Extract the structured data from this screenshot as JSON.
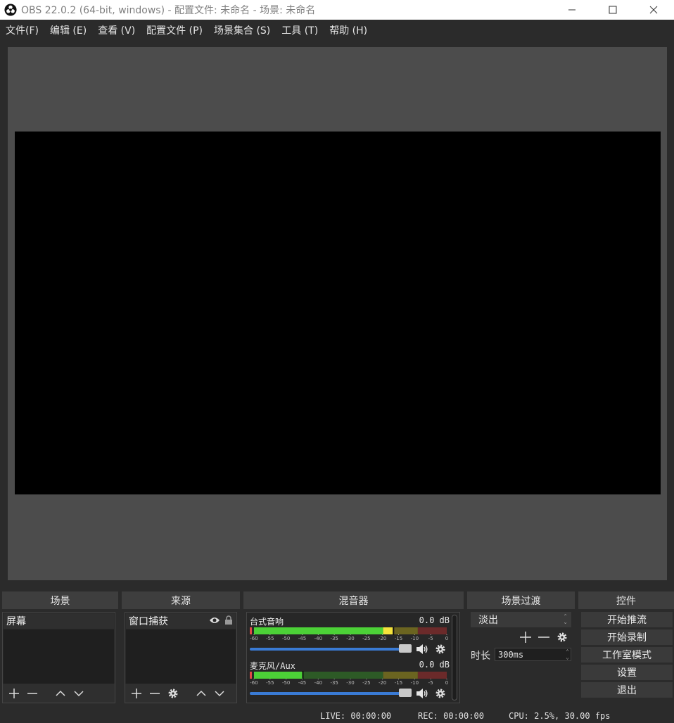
{
  "window": {
    "title": "OBS 22.0.2 (64-bit, windows) - 配置文件: 未命名 - 场景: 未命名",
    "minimize_glyph": "—",
    "maximize_glyph": "☐",
    "close_glyph": "✕"
  },
  "menu": [
    "文件(F)",
    "编辑 (E)",
    "查看 (V)",
    "配置文件 (P)",
    "场景集合 (S)",
    "工具 (T)",
    "帮助 (H)"
  ],
  "docks": {
    "scenes": {
      "title": "场景",
      "items": [
        "屏幕"
      ]
    },
    "sources": {
      "title": "来源",
      "items": [
        "窗口捕获"
      ]
    },
    "mixer": {
      "title": "混音器",
      "channels": [
        {
          "name": "台式音响",
          "db": "0.0 dB",
          "level": 0.72
        },
        {
          "name": "麦克风/Aux",
          "db": "0.0 dB",
          "level": 0.25
        }
      ],
      "scale": [
        "-60",
        "-55",
        "-50",
        "-45",
        "-40",
        "-35",
        "-30",
        "-25",
        "-20",
        "-15",
        "-10",
        "-5",
        "0"
      ]
    },
    "transitions": {
      "title": "场景过渡",
      "selected": "淡出",
      "duration_label": "时长",
      "duration_value": "300ms"
    },
    "controls": {
      "title": "控件",
      "buttons": [
        "开始推流",
        "开始录制",
        "工作室模式",
        "设置",
        "退出"
      ]
    }
  },
  "status": {
    "live": "LIVE: 00:00:00",
    "rec": "REC: 00:00:00",
    "cpu": "CPU: 2.5%, 30.00 fps"
  },
  "colors": {
    "accent": "#3a7bd5",
    "meter_green": "#4cd137",
    "meter_yellow": "#f5e33c",
    "meter_red": "#e04848"
  }
}
